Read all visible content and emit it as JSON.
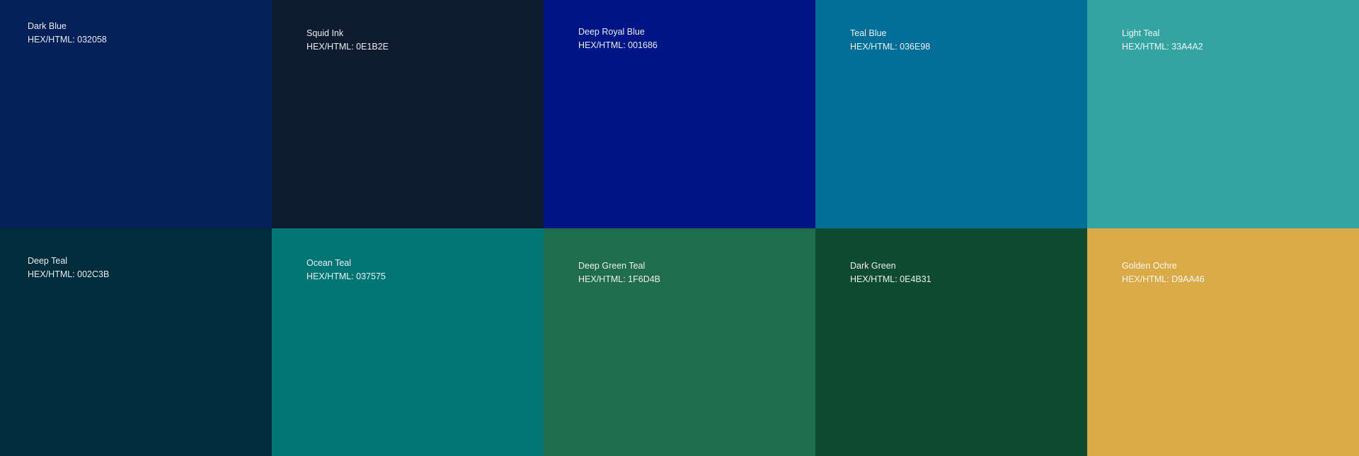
{
  "code_prefix": "HEX/HTML: ",
  "swatches": [
    {
      "name": "Dark Blue",
      "hex": "032058",
      "color": "#032058"
    },
    {
      "name": "Squid Ink",
      "hex": "0E1B2E",
      "color": "#0E1B2E"
    },
    {
      "name": "Deep Royal Blue",
      "hex": "001686",
      "color": "#001686"
    },
    {
      "name": "Teal Blue",
      "hex": "036E98",
      "color": "#036E98"
    },
    {
      "name": "Light Teal",
      "hex": "33A4A2",
      "color": "#33A4A2"
    },
    {
      "name": "Deep Teal",
      "hex": "002C3B",
      "color": "#002C3B"
    },
    {
      "name": "Ocean Teal",
      "hex": "037575",
      "color": "#037575"
    },
    {
      "name": "Deep Green Teal",
      "hex": "1F6D4B",
      "color": "#1F6D4B"
    },
    {
      "name": "Dark Green",
      "hex": "0E4B31",
      "color": "#0E4B31"
    },
    {
      "name": "Golden Ochre",
      "hex": "D9AA46",
      "color": "#D9AA46"
    }
  ]
}
